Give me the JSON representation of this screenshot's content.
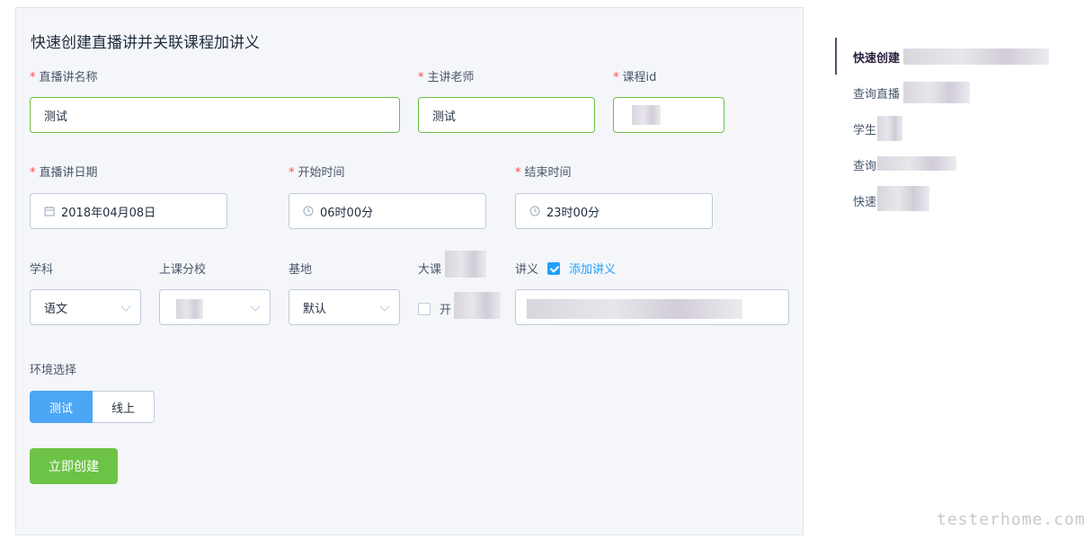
{
  "form": {
    "title": "快速创建直播讲并关联课程加讲义",
    "required_mark": "*",
    "live_name": {
      "label": "直播讲名称",
      "value": "测试"
    },
    "teacher": {
      "label": "主讲老师",
      "value": "测试"
    },
    "course_id": {
      "label": "课程id",
      "value": ""
    },
    "live_date": {
      "label": "直播讲日期",
      "value": "2018年04月08日"
    },
    "start_time": {
      "label": "开始时间",
      "value": "06时00分"
    },
    "end_time": {
      "label": "结束时间",
      "value": "23时00分"
    },
    "subject": {
      "label": "学科",
      "value": "语文"
    },
    "campus": {
      "label": "上课分校",
      "value": ""
    },
    "base": {
      "label": "基地",
      "value": "默认"
    },
    "big_class": {
      "label": "大课",
      "option_label": "开"
    },
    "handout": {
      "label": "讲义",
      "checkbox_label": "添加讲义",
      "checked": true,
      "value": ""
    },
    "env": {
      "label": "环境选择",
      "options": [
        "测试",
        "线上"
      ],
      "selected": "测试"
    },
    "submit_label": "立即创建"
  },
  "nav": {
    "items": [
      {
        "label": "快速创建",
        "active": true
      },
      {
        "label": "查询直播",
        "active": false
      },
      {
        "label": "学生",
        "active": false
      },
      {
        "label": "查询",
        "active": false
      },
      {
        "label": "快速",
        "active": false
      }
    ]
  },
  "watermark": "testerhome.com",
  "colors": {
    "accent": "#20a0ff",
    "success": "#6dc346",
    "required": "#ff4949",
    "nav_active_bar": "#5c4a6b"
  }
}
